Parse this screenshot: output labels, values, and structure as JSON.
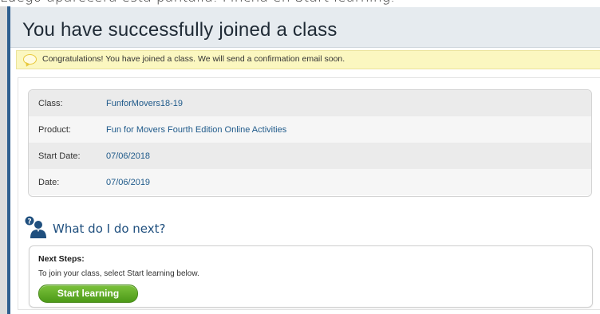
{
  "caption": "Luego aparecerá esta pantalla. Pincha en Start learning.",
  "header": {
    "title": "You have successfully joined a class"
  },
  "notice": {
    "message": "Congratulations! You have joined a class. We will send a confirmation email soon."
  },
  "details": [
    {
      "label": "Class:",
      "value": "FunforMovers18-19"
    },
    {
      "label": "Product:",
      "value": "Fun for Movers Fourth Edition Online Activities"
    },
    {
      "label": "Start Date:",
      "value": "07/06/2018"
    },
    {
      "label": "Date:",
      "value": "07/06/2019"
    }
  ],
  "next": {
    "title": "What do I do next?",
    "steps_heading": "Next Steps:",
    "steps_text": "To join your class, select Start learning below.",
    "button_label": "Start learning"
  },
  "icons": {
    "notice": "speech-bubble-icon",
    "next": "question-person-icon"
  },
  "colors": {
    "accent_blue": "#1f4f7e",
    "button_green": "#5aa623",
    "notice_bg": "#fbf7c0"
  }
}
